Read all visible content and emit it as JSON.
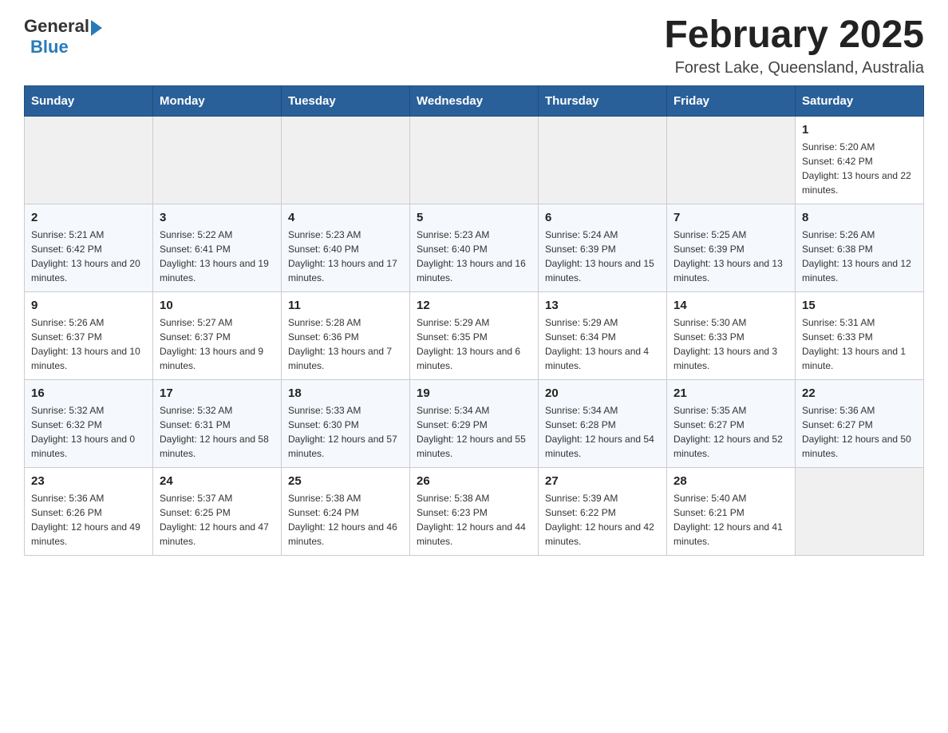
{
  "header": {
    "logo_general": "General",
    "logo_blue": "Blue",
    "month_title": "February 2025",
    "location": "Forest Lake, Queensland, Australia"
  },
  "weekdays": [
    "Sunday",
    "Monday",
    "Tuesday",
    "Wednesday",
    "Thursday",
    "Friday",
    "Saturday"
  ],
  "weeks": [
    [
      {
        "day": "",
        "info": ""
      },
      {
        "day": "",
        "info": ""
      },
      {
        "day": "",
        "info": ""
      },
      {
        "day": "",
        "info": ""
      },
      {
        "day": "",
        "info": ""
      },
      {
        "day": "",
        "info": ""
      },
      {
        "day": "1",
        "info": "Sunrise: 5:20 AM\nSunset: 6:42 PM\nDaylight: 13 hours and 22 minutes."
      }
    ],
    [
      {
        "day": "2",
        "info": "Sunrise: 5:21 AM\nSunset: 6:42 PM\nDaylight: 13 hours and 20 minutes."
      },
      {
        "day": "3",
        "info": "Sunrise: 5:22 AM\nSunset: 6:41 PM\nDaylight: 13 hours and 19 minutes."
      },
      {
        "day": "4",
        "info": "Sunrise: 5:23 AM\nSunset: 6:40 PM\nDaylight: 13 hours and 17 minutes."
      },
      {
        "day": "5",
        "info": "Sunrise: 5:23 AM\nSunset: 6:40 PM\nDaylight: 13 hours and 16 minutes."
      },
      {
        "day": "6",
        "info": "Sunrise: 5:24 AM\nSunset: 6:39 PM\nDaylight: 13 hours and 15 minutes."
      },
      {
        "day": "7",
        "info": "Sunrise: 5:25 AM\nSunset: 6:39 PM\nDaylight: 13 hours and 13 minutes."
      },
      {
        "day": "8",
        "info": "Sunrise: 5:26 AM\nSunset: 6:38 PM\nDaylight: 13 hours and 12 minutes."
      }
    ],
    [
      {
        "day": "9",
        "info": "Sunrise: 5:26 AM\nSunset: 6:37 PM\nDaylight: 13 hours and 10 minutes."
      },
      {
        "day": "10",
        "info": "Sunrise: 5:27 AM\nSunset: 6:37 PM\nDaylight: 13 hours and 9 minutes."
      },
      {
        "day": "11",
        "info": "Sunrise: 5:28 AM\nSunset: 6:36 PM\nDaylight: 13 hours and 7 minutes."
      },
      {
        "day": "12",
        "info": "Sunrise: 5:29 AM\nSunset: 6:35 PM\nDaylight: 13 hours and 6 minutes."
      },
      {
        "day": "13",
        "info": "Sunrise: 5:29 AM\nSunset: 6:34 PM\nDaylight: 13 hours and 4 minutes."
      },
      {
        "day": "14",
        "info": "Sunrise: 5:30 AM\nSunset: 6:33 PM\nDaylight: 13 hours and 3 minutes."
      },
      {
        "day": "15",
        "info": "Sunrise: 5:31 AM\nSunset: 6:33 PM\nDaylight: 13 hours and 1 minute."
      }
    ],
    [
      {
        "day": "16",
        "info": "Sunrise: 5:32 AM\nSunset: 6:32 PM\nDaylight: 13 hours and 0 minutes."
      },
      {
        "day": "17",
        "info": "Sunrise: 5:32 AM\nSunset: 6:31 PM\nDaylight: 12 hours and 58 minutes."
      },
      {
        "day": "18",
        "info": "Sunrise: 5:33 AM\nSunset: 6:30 PM\nDaylight: 12 hours and 57 minutes."
      },
      {
        "day": "19",
        "info": "Sunrise: 5:34 AM\nSunset: 6:29 PM\nDaylight: 12 hours and 55 minutes."
      },
      {
        "day": "20",
        "info": "Sunrise: 5:34 AM\nSunset: 6:28 PM\nDaylight: 12 hours and 54 minutes."
      },
      {
        "day": "21",
        "info": "Sunrise: 5:35 AM\nSunset: 6:27 PM\nDaylight: 12 hours and 52 minutes."
      },
      {
        "day": "22",
        "info": "Sunrise: 5:36 AM\nSunset: 6:27 PM\nDaylight: 12 hours and 50 minutes."
      }
    ],
    [
      {
        "day": "23",
        "info": "Sunrise: 5:36 AM\nSunset: 6:26 PM\nDaylight: 12 hours and 49 minutes."
      },
      {
        "day": "24",
        "info": "Sunrise: 5:37 AM\nSunset: 6:25 PM\nDaylight: 12 hours and 47 minutes."
      },
      {
        "day": "25",
        "info": "Sunrise: 5:38 AM\nSunset: 6:24 PM\nDaylight: 12 hours and 46 minutes."
      },
      {
        "day": "26",
        "info": "Sunrise: 5:38 AM\nSunset: 6:23 PM\nDaylight: 12 hours and 44 minutes."
      },
      {
        "day": "27",
        "info": "Sunrise: 5:39 AM\nSunset: 6:22 PM\nDaylight: 12 hours and 42 minutes."
      },
      {
        "day": "28",
        "info": "Sunrise: 5:40 AM\nSunset: 6:21 PM\nDaylight: 12 hours and 41 minutes."
      },
      {
        "day": "",
        "info": ""
      }
    ]
  ]
}
